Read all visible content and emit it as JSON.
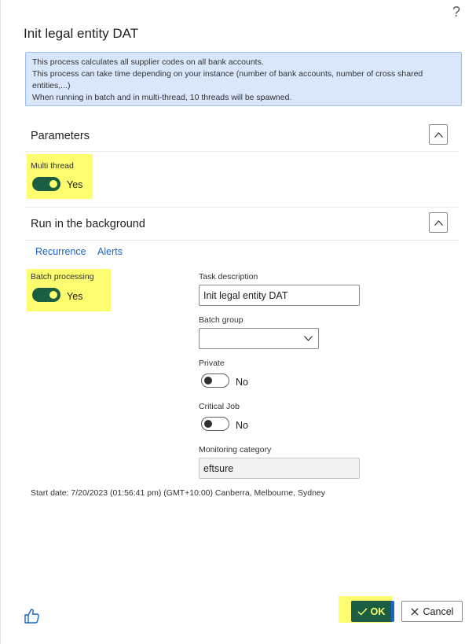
{
  "dialog": {
    "help_label": "?",
    "title": "Init legal entity DAT",
    "info_lines": [
      "This process calculates all supplier codes on all bank accounts.",
      "This process can take time depending on your instance (number of bank accounts, number of cross shared entities,...)",
      "When running in batch and in multi-thread, 10 threads will be spawned."
    ]
  },
  "parameters": {
    "title": "Parameters",
    "multi_thread": {
      "label": "Multi thread",
      "value": "Yes",
      "on": true
    }
  },
  "background": {
    "title": "Run in the background",
    "links": [
      "Recurrence",
      "Alerts"
    ],
    "batch_processing": {
      "label": "Batch processing",
      "value": "Yes",
      "on": true
    },
    "task_description": {
      "label": "Task description",
      "value": "Init legal entity DAT"
    },
    "batch_group": {
      "label": "Batch group",
      "value": ""
    },
    "private": {
      "label": "Private",
      "value": "No",
      "on": false
    },
    "critical_job": {
      "label": "Critical Job",
      "value": "No",
      "on": false
    },
    "monitoring_category": {
      "label": "Monitoring category",
      "value": "eftsure"
    },
    "start_date": "Start date: 7/20/2023 (01:56:41 pm) (GMT+10:00) Canberra, Melbourne, Sydney"
  },
  "footer": {
    "ok_label": "OK",
    "cancel_label": "Cancel"
  },
  "colors": {
    "accent_green": "#1c5e41",
    "highlight_yellow": "#fdfd6f",
    "link_blue": "#1a63c7",
    "info_bg": "#d8e7fc"
  }
}
